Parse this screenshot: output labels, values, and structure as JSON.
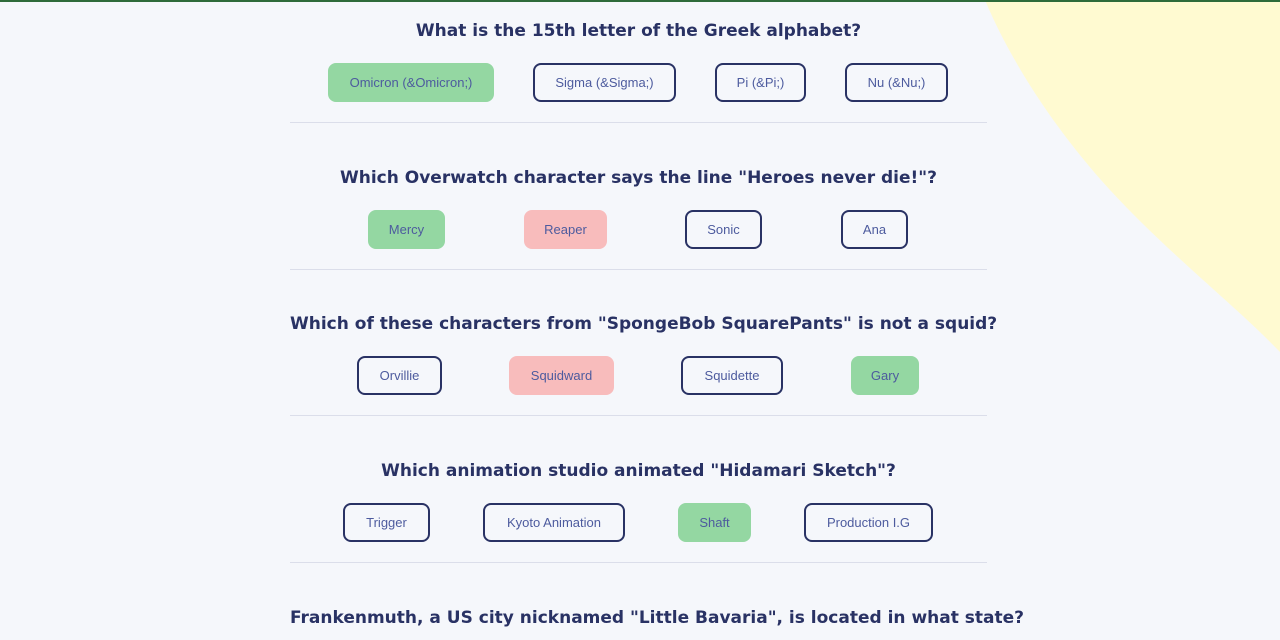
{
  "colors": {
    "background": "#F5F7FB",
    "blob": "#FFFAD1",
    "text": "#293264",
    "answer_text": "#4D5B9E",
    "correct": "#94D7A2",
    "wrong": "#F8BCBC",
    "divider": "#DBDEEA"
  },
  "questions": [
    {
      "text": "What is the 15th letter of the Greek alphabet?",
      "answers": [
        {
          "label": "Omicron (&Omicron;)",
          "state": "correct"
        },
        {
          "label": "Sigma (&Sigma;)",
          "state": "unselected"
        },
        {
          "label": "Pi (&Pi;)",
          "state": "unselected"
        },
        {
          "label": "Nu (&Nu;)",
          "state": "unselected"
        }
      ]
    },
    {
      "text": "Which Overwatch character says the line \"Heroes never die!\"?",
      "answers": [
        {
          "label": "Mercy",
          "state": "correct"
        },
        {
          "label": "Reaper",
          "state": "wrong"
        },
        {
          "label": "Sonic",
          "state": "unselected"
        },
        {
          "label": "Ana",
          "state": "unselected"
        }
      ]
    },
    {
      "text": "Which of these characters from \"SpongeBob SquarePants\" is not a squid?",
      "answers": [
        {
          "label": "Orvillie",
          "state": "unselected"
        },
        {
          "label": "Squidward",
          "state": "wrong"
        },
        {
          "label": "Squidette",
          "state": "unselected"
        },
        {
          "label": "Gary",
          "state": "correct"
        }
      ]
    },
    {
      "text": "Which animation studio animated \"Hidamari Sketch\"?",
      "answers": [
        {
          "label": "Trigger",
          "state": "unselected"
        },
        {
          "label": "Kyoto Animation",
          "state": "unselected"
        },
        {
          "label": "Shaft",
          "state": "correct"
        },
        {
          "label": "Production I.G",
          "state": "unselected"
        }
      ]
    },
    {
      "text": "Frankenmuth, a US city nicknamed \"Little Bavaria\", is located in what state?",
      "answers": []
    }
  ]
}
